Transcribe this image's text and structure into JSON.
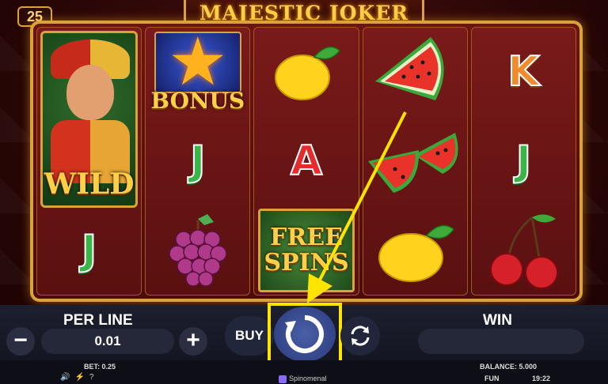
{
  "game": {
    "title": "MAJESTIC JOKER",
    "lines": "25"
  },
  "reels": {
    "reel1": {
      "wild_label": "WILD",
      "bottom_symbol": "J"
    },
    "reel2": {
      "top_label": "BONUS",
      "mid_symbol": "J",
      "bottom_symbol": "grapes"
    },
    "reel3": {
      "top_symbol": "lemon",
      "mid_symbol": "A",
      "bottom_label_line1": "FREE",
      "bottom_label_line2": "SPINS"
    },
    "reel4": {
      "top_symbol": "watermelon",
      "mid_symbol": "watermelon",
      "bottom_symbol": "lemon"
    },
    "reel5": {
      "top_symbol": "K",
      "mid_symbol": "J",
      "bottom_symbol": "cherries"
    }
  },
  "controls": {
    "per_line_label": "PER LINE",
    "per_line_value": "0.01",
    "minus_label": "−",
    "plus_label": "+",
    "buy_label": "BUY",
    "win_label": "WIN",
    "win_value": ""
  },
  "footer": {
    "bet_label": "BET: 0.25",
    "balance_label": "BALANCE: 5.000",
    "mode_label": "FUN",
    "time": "19:22",
    "brand": "Spinomenal",
    "help_label": "?"
  },
  "colors": {
    "accent_gold": "#d9a23a",
    "highlight": "#ffe400",
    "spin_button": "#3a4f98"
  }
}
